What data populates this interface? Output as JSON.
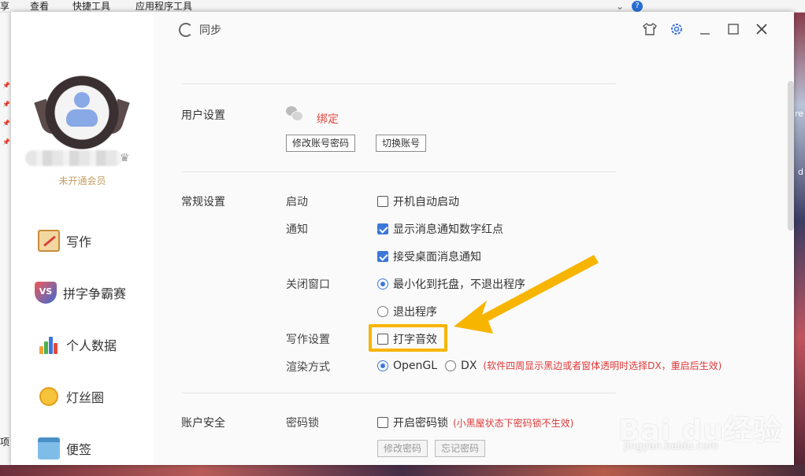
{
  "explorer": {
    "menu_share": "享",
    "menu_view": "查看",
    "menu_quick_tools": "快捷工具",
    "menu_app_tools": "应用程序工具",
    "side_text_1": "re",
    "side_text_2": "d",
    "side_text_3": "项"
  },
  "sidebar": {
    "vip_status": "未开通会员",
    "items": [
      {
        "label": "写作",
        "icon": "writing-icon"
      },
      {
        "label": "拼字争霸赛",
        "icon": "vs-icon"
      },
      {
        "label": "个人数据",
        "icon": "chart-icon"
      },
      {
        "label": "灯丝圈",
        "icon": "bulb-icon"
      },
      {
        "label": "便签",
        "icon": "note-icon"
      }
    ]
  },
  "toolbar": {
    "sync_label": "同步",
    "icons": [
      "shirt-icon",
      "gear-icon",
      "minimize-icon",
      "maximize-icon",
      "close-icon"
    ]
  },
  "user_settings": {
    "title": "用户设置",
    "bind_label": "绑定",
    "change_password_button": "修改账号密码",
    "switch_account_button": "切换账号"
  },
  "general_settings": {
    "title": "常规设置",
    "startup_label": "启动",
    "startup_option": "开机自动启动",
    "startup_checked": false,
    "notify_label": "通知",
    "notify_option_1": "显示消息通知数字红点",
    "notify_option_1_checked": true,
    "notify_option_2": "接受桌面消息通知",
    "notify_option_2_checked": true,
    "close_label": "关闭窗口",
    "close_option_1": "最小化到托盘，不退出程序",
    "close_option_1_selected": true,
    "close_option_2": "退出程序",
    "writing_label": "写作设置",
    "writing_option": "打字音效",
    "writing_checked": false,
    "render_label": "渲染方式",
    "render_option_1": "OpenGL",
    "render_option_1_selected": true,
    "render_option_2": "DX",
    "render_note": "(软件四周显示黑边或者窗体透明时选择DX，重启后生效)"
  },
  "account_security": {
    "title": "账户安全",
    "lock_label": "密码锁",
    "lock_option": "开启密码锁",
    "lock_checked": false,
    "lock_note": "(小黑屋状态下密码锁不生效)",
    "modify_password_button": "修改密码",
    "forgot_password_button": "忘记密码"
  },
  "watermark": {
    "logo": "Bai du经验",
    "url": "jingyan.baidu.com"
  },
  "colors": {
    "accent": "#3d78d8",
    "highlight": "#f7b500",
    "warning_text": "#e03a3a",
    "bind_link": "#e24a3b",
    "vip_text": "#c4a067"
  }
}
